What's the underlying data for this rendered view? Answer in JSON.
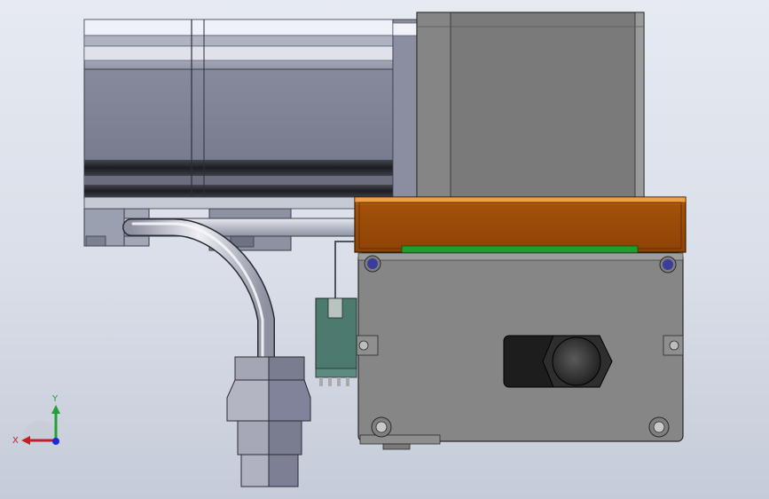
{
  "viewport": {
    "background_top": "#e6eaf1",
    "background_bottom": "#c5cbd8"
  },
  "model": {
    "parts": [
      "servo-motor-body",
      "gearbox-housing",
      "mounting-bracket",
      "motor-flange-plate",
      "cable-with-connector",
      "terminal-connector",
      "shaft-coupling"
    ],
    "colors": {
      "motor": "#7c8193",
      "motor_dark": "#2a2c34",
      "gearbox": "#7a7a7a",
      "bracket": "#9c4a05",
      "bracket_edge": "#d07a1c",
      "pcb_strip": "#1f9e2c",
      "plate": "#858585",
      "connector": "#555a60",
      "cable": "#b8bcc8"
    }
  },
  "triad": {
    "x_label": "X",
    "y_label": "Y",
    "x_color": "#c0202a",
    "y_color": "#22a035",
    "z_color": "#1c2bd8"
  }
}
